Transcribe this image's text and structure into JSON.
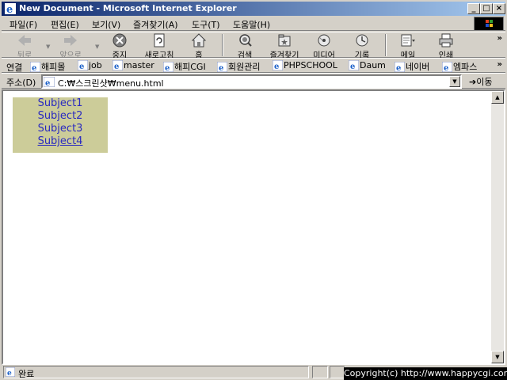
{
  "window": {
    "title": "New Document - Microsoft Internet Explorer",
    "controls": {
      "minimize": "_",
      "maximize": "□",
      "close": "×"
    }
  },
  "menubar": {
    "items": [
      "파일(F)",
      "편집(E)",
      "보기(V)",
      "즐겨찾기(A)",
      "도구(T)",
      "도움말(H)"
    ]
  },
  "toolbar": {
    "buttons": [
      {
        "label": "뒤로",
        "icon": "back-arrow-icon",
        "enabled": false
      },
      {
        "label": "앞으로",
        "icon": "forward-arrow-icon",
        "enabled": false
      },
      {
        "label": "중지",
        "icon": "stop-icon",
        "enabled": true
      },
      {
        "label": "새로고침",
        "icon": "refresh-icon",
        "enabled": true
      },
      {
        "label": "홈",
        "icon": "home-icon",
        "enabled": true
      },
      {
        "label": "검색",
        "icon": "search-icon",
        "enabled": true
      },
      {
        "label": "즐겨찾기",
        "icon": "favorites-icon",
        "enabled": true
      },
      {
        "label": "미디어",
        "icon": "media-icon",
        "enabled": true
      },
      {
        "label": "기록",
        "icon": "history-icon",
        "enabled": true
      },
      {
        "label": "메일",
        "icon": "mail-icon",
        "enabled": true
      },
      {
        "label": "인쇄",
        "icon": "print-icon",
        "enabled": true
      }
    ]
  },
  "links": {
    "label": "연결",
    "items": [
      "해피몰",
      "job",
      "master",
      "해피CGI",
      "회원관리",
      "PHPSCHOOL",
      "Daum",
      "네이버",
      "엠파스"
    ]
  },
  "address": {
    "label": "주소(D)",
    "value": "C:₩스크린샷₩menu.html",
    "go_label": "이동"
  },
  "page": {
    "menu": [
      "Subject1",
      "Subject2",
      "Subject3",
      "Subject4"
    ],
    "hovered_index": 3,
    "box_color": "#cccc99",
    "link_color": "#2a2ac0"
  },
  "status": {
    "text": "완료"
  },
  "overlay": {
    "copyright": "Copyright(c) http://www.happycgi.com"
  }
}
